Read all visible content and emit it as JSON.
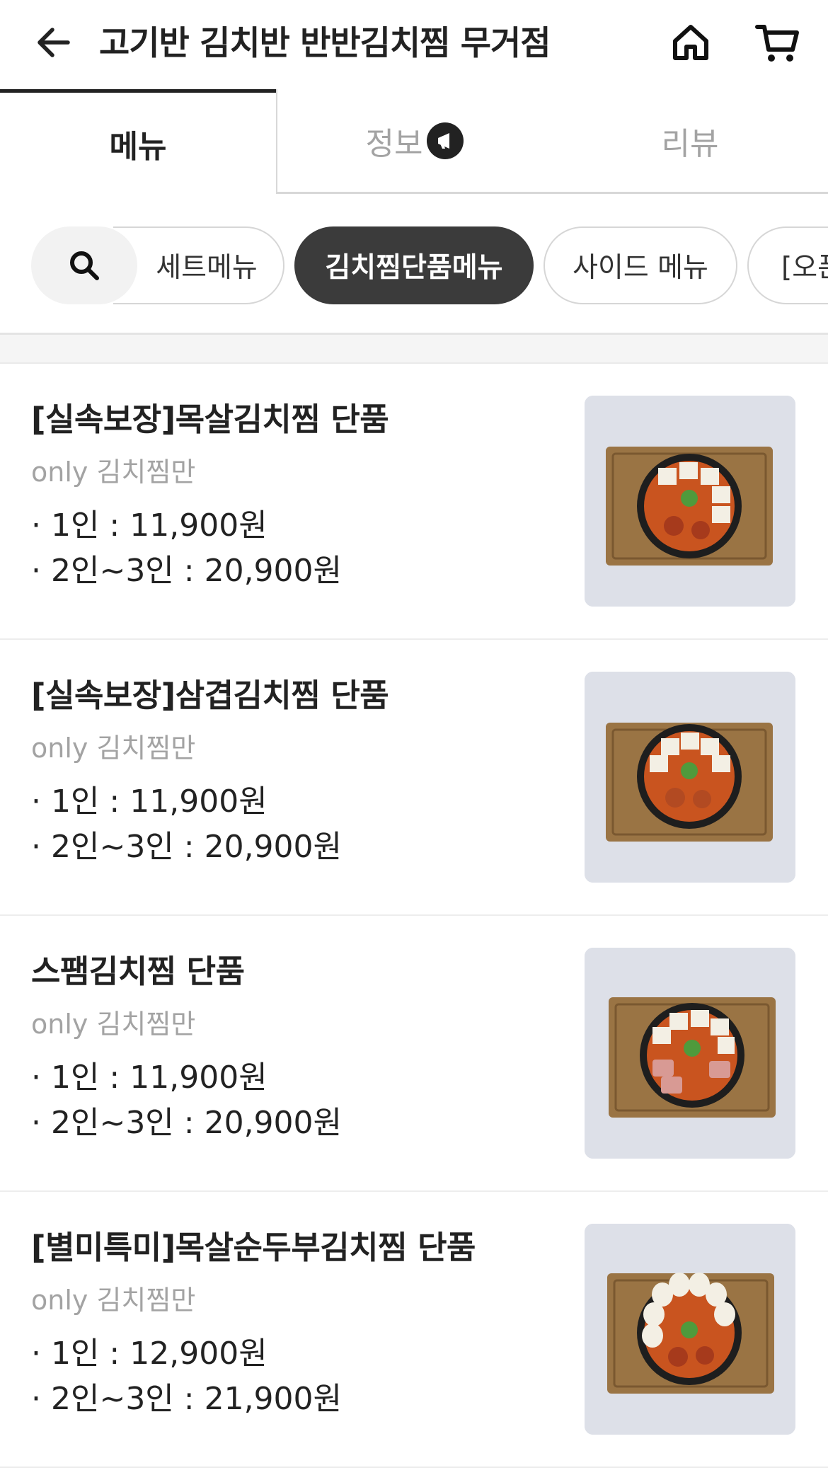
{
  "header": {
    "title": "고기반 김치반 반반김치찜 무거점",
    "back_icon": "arrow-left-icon",
    "home_icon": "home-icon",
    "cart_icon": "cart-icon"
  },
  "tabs": [
    {
      "label": "메뉴",
      "active": true
    },
    {
      "label": "정보",
      "active": false,
      "icon": "megaphone-icon"
    },
    {
      "label": "리뷰",
      "active": false
    }
  ],
  "categories": {
    "search_icon": "search-icon",
    "items": [
      {
        "label": "세트메뉴",
        "active": false
      },
      {
        "label": "김치찜단품메뉴",
        "active": true
      },
      {
        "label": "사이드 메뉴",
        "active": false
      },
      {
        "label": "[오픈",
        "active": false
      }
    ]
  },
  "menu": [
    {
      "name": "[실속보장]목살김치찜 단품",
      "description": "only 김치찜만",
      "prices": [
        "· 1인 : 11,900원",
        "· 2인~3인 : 20,900원"
      ]
    },
    {
      "name": "[실속보장]삼겹김치찜 단품",
      "description": "only 김치찜만",
      "prices": [
        "· 1인 : 11,900원",
        "· 2인~3인 : 20,900원"
      ]
    },
    {
      "name": "스팸김치찜 단품",
      "description": "only 김치찜만",
      "prices": [
        "· 1인 : 11,900원",
        "· 2인~3인 : 20,900원"
      ]
    },
    {
      "name": "[별미특미]목살순두부김치찜 단품",
      "description": "only 김치찜만",
      "prices": [
        "· 1인 : 12,900원",
        "· 2인~3인 : 21,900원"
      ]
    }
  ],
  "colors": {
    "text": "#222222",
    "muted": "#a3a3a3",
    "active_chip": "#3b3b3b",
    "divider": "#ededed"
  }
}
